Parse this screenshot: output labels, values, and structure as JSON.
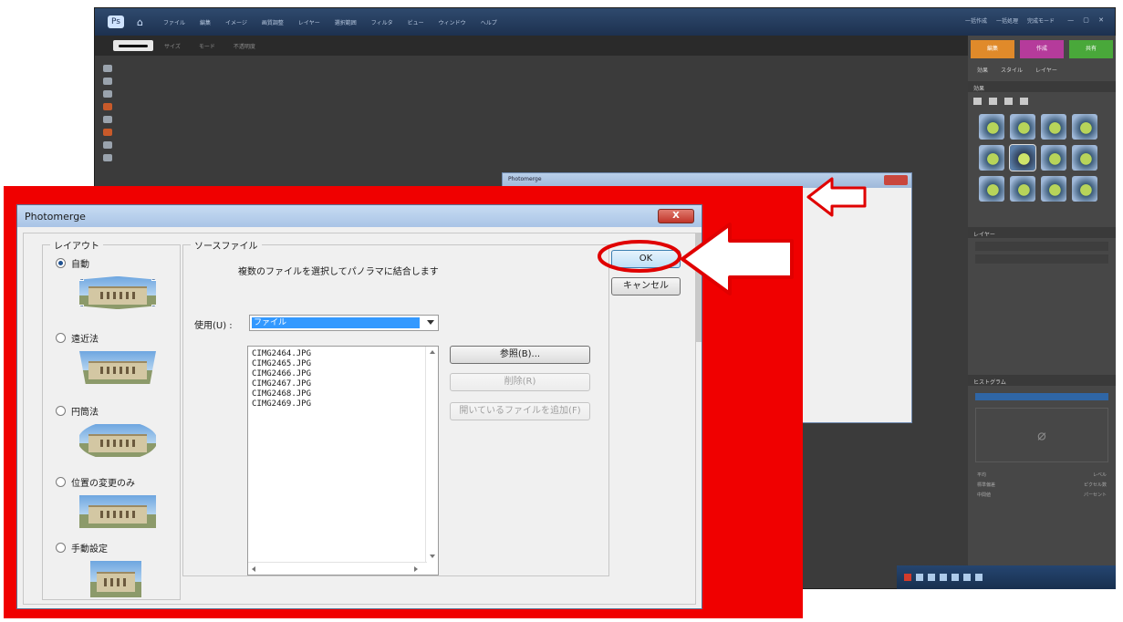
{
  "app": {
    "menus": [
      "ファイル",
      "編集",
      "イメージ",
      "画質調整",
      "レイヤー",
      "選択範囲",
      "フィルタ",
      "ビュー",
      "ウィンドウ",
      "ヘルプ"
    ],
    "right_menu": [
      "一括作成",
      "一括処理",
      "完成モード"
    ],
    "mode_tabs": [
      "編集",
      "作成",
      "共有"
    ],
    "sub_tabs": [
      "効果",
      "スタイル",
      "レイヤー"
    ],
    "panels": [
      "効果",
      "レイヤー",
      "ヒストグラム"
    ]
  },
  "bg_dialog": {
    "title": "Photomerge"
  },
  "dialog": {
    "title": "Photomerge",
    "close_label": "X",
    "layout": {
      "legend": "レイアウト",
      "options": [
        {
          "label": "自動",
          "selected": true
        },
        {
          "label": "遠近法",
          "selected": false
        },
        {
          "label": "円筒法",
          "selected": false
        },
        {
          "label": "位置の変更のみ",
          "selected": false
        },
        {
          "label": "手動設定",
          "selected": false
        }
      ]
    },
    "source": {
      "legend": "ソースファイル",
      "description": "複数のファイルを選択してパノラマに結合します",
      "use_label": "使用(U) :",
      "use_value": "ファイル",
      "files": [
        "CIMG2464.JPG",
        "CIMG2465.JPG",
        "CIMG2466.JPG",
        "CIMG2467.JPG",
        "CIMG2468.JPG",
        "CIMG2469.JPG"
      ],
      "browse_label": "参照(B)...",
      "remove_label": "削除(R)",
      "add_open_label": "開いているファイルを追加(F)"
    },
    "ok_label": "OK",
    "cancel_label": "キャンセル"
  },
  "colors": {
    "highlight_frame": "#f00000",
    "selection": "#3399ff",
    "mode_edit": "#e08a2a",
    "mode_create": "#b53b9b",
    "mode_share": "#49a83a"
  },
  "annotations": {
    "ok_button_highlight": "red-ellipse",
    "ok_button_arrow": "red-arrow-left",
    "bg_window_arrow": "red-arrow-left"
  }
}
